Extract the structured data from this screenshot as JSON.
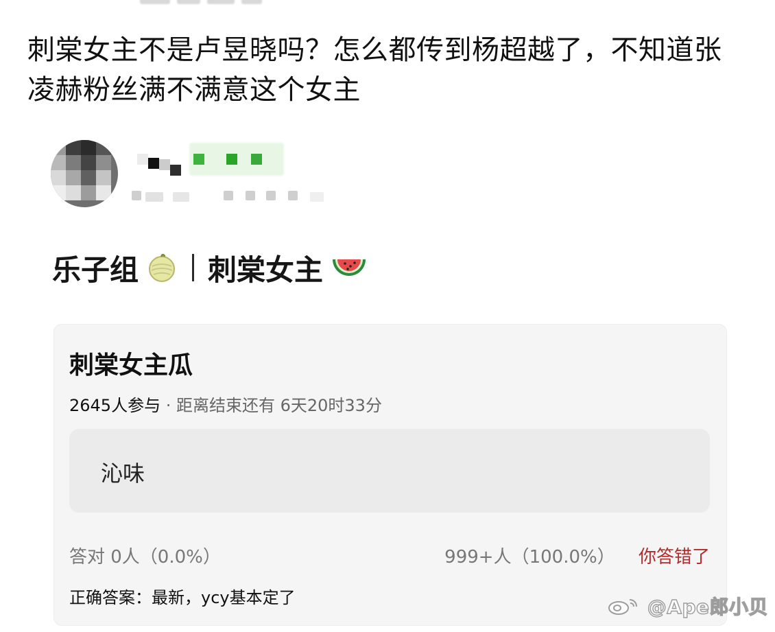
{
  "headline": "刺棠女主不是卢昱晓吗？怎么都传到杨超越了，不知道张凌赫粉丝满不满意这个女主",
  "post": {
    "group_label": "乐子组",
    "group_emoji": "melon-emoji",
    "topic_label": "刺棠女主",
    "topic_emoji": "watermelon-emoji"
  },
  "vote_card": {
    "title": "刺棠女主瓜",
    "participants": "2645人参与",
    "separator": " · ",
    "deadline": "距离结束还有 6天20时33分",
    "option_label": "沁味",
    "correct_stats": "答对  0人（0.0%）",
    "option_stats": "999+人（100.0%）",
    "wrong_label": "你答错了",
    "answer": "正确答案：最新，ycy基本定了"
  },
  "watermark": {
    "logo": "weibo-icon",
    "text": "@Ape郎小贝"
  },
  "colors": {
    "wrong": "#b42b2b",
    "card_bg": "#f5f5f5",
    "option_bg": "#ebebeb"
  }
}
